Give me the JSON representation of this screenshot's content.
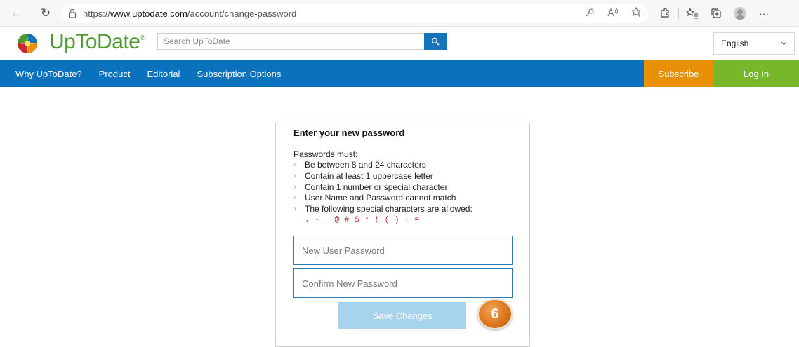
{
  "browser": {
    "url_prefix": "https://",
    "url_domain": "www.uptodate.com",
    "url_path": "/account/change-password",
    "more_label": "···"
  },
  "header": {
    "brand": "UpToDate",
    "brand_mark": "®",
    "search_placeholder": "Search UpToDate",
    "language": "English"
  },
  "nav": {
    "items": [
      {
        "label": "Why UpToDate?"
      },
      {
        "label": "Product"
      },
      {
        "label": "Editorial"
      },
      {
        "label": "Subscription Options"
      }
    ],
    "subscribe": "Subscribe",
    "login": "Log In"
  },
  "form": {
    "title": "Enter your new password",
    "rules_heading": "Passwords must:",
    "rules": [
      "Be between 8 and 24 characters",
      "Contain at least 1 uppercase letter",
      "Contain 1 number or special character",
      "User Name and Password cannot match",
      "The following special characters are allowed:"
    ],
    "special_chars": ". - _ @ # $ * ! ( ) + =",
    "new_password_placeholder": "New User Password",
    "confirm_password_placeholder": "Confirm New Password",
    "save_label": "Save Changes"
  },
  "annotation": {
    "step_number": "6"
  },
  "colors": {
    "brand_green": "#4a9a2c",
    "nav_blue": "#0a72bd",
    "subscribe_orange": "#e99007",
    "login_green": "#76b82a",
    "special_chars_red": "#c41e1e"
  }
}
